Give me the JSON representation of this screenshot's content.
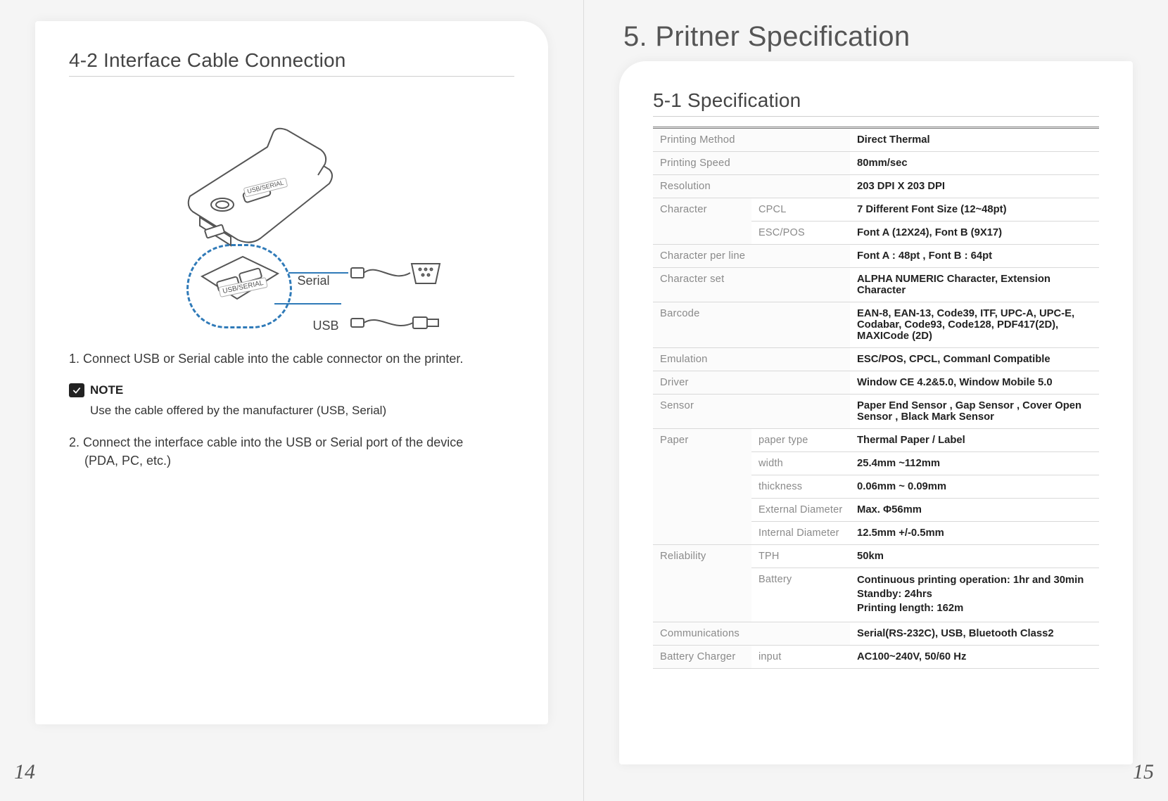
{
  "left": {
    "section_title": "4-2 Interface Cable Connection",
    "illustration": {
      "port_label": "USB/SERIAL",
      "serial_label": "Serial",
      "usb_label": "USB"
    },
    "step1": "1. Connect USB or Serial cable into the cable connector on the printer.",
    "note_heading": "NOTE",
    "note_body": "Use the cable offered by the manufacturer (USB, Serial)",
    "step2_line1": "2. Connect the interface cable into the USB or Serial port of the device",
    "step2_line2": "(PDA, PC, etc.)",
    "page_number": "14"
  },
  "right": {
    "chapter_title": "5. Pritner Specification",
    "section_title": "5-1 Specification",
    "page_number": "15",
    "spec": {
      "printing_method": {
        "label": "Printing Method",
        "value": "Direct Thermal"
      },
      "printing_speed": {
        "label": "Printing Speed",
        "value": "80mm/sec"
      },
      "resolution": {
        "label": "Resolution",
        "value": "203 DPI X 203 DPI"
      },
      "character": {
        "label": "Character",
        "cpcl": {
          "label": "CPCL",
          "value": "7 Different Font Size (12~48pt)"
        },
        "escpos": {
          "label": "ESC/POS",
          "value": "Font A (12X24), Font B (9X17)"
        }
      },
      "char_per_line": {
        "label": "Character per line",
        "value": "Font A : 48pt , Font B : 64pt"
      },
      "char_set": {
        "label": "Character set",
        "value": "ALPHA NUMERIC Character, Extension Character"
      },
      "barcode": {
        "label": "Barcode",
        "value": "EAN-8, EAN-13, Code39, ITF, UPC-A, UPC-E, Codabar, Code93, Code128, PDF417(2D), MAXICode (2D)"
      },
      "emulation": {
        "label": "Emulation",
        "value": "ESC/POS, CPCL, Commanl Compatible"
      },
      "driver": {
        "label": "Driver",
        "value": "Window CE 4.2&5.0, Window Mobile 5.0"
      },
      "sensor": {
        "label": "Sensor",
        "value": "Paper End Sensor , Gap Sensor , Cover Open Sensor , Black Mark Sensor"
      },
      "paper": {
        "label": "Paper",
        "type": {
          "label": "paper type",
          "value": "Thermal Paper / Label"
        },
        "width": {
          "label": "width",
          "value": "25.4mm ~112mm"
        },
        "thickness": {
          "label": "thickness",
          "value": "0.06mm ~ 0.09mm"
        },
        "ext_dia": {
          "label": "External Diameter",
          "value": "Max. Φ56mm"
        },
        "int_dia": {
          "label": "Internal Diameter",
          "value": "12.5mm +/-0.5mm"
        }
      },
      "reliability": {
        "label": "Reliability",
        "tph": {
          "label": "TPH",
          "value": "50km"
        },
        "battery": {
          "label": "Battery",
          "line1": "Continuous printing operation: 1hr and 30min",
          "line2": "Standby: 24hrs",
          "line3": "Printing length: 162m"
        }
      },
      "communications": {
        "label": "Communications",
        "value": "Serial(RS-232C), USB, Bluetooth Class2"
      },
      "charger": {
        "label": "Battery Charger",
        "input": {
          "label": "input",
          "value": "AC100~240V, 50/60 Hz"
        }
      }
    }
  }
}
